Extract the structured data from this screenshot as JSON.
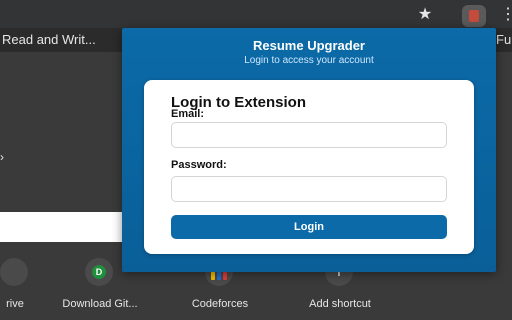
{
  "browser": {
    "star_icon": "★",
    "menu_icon": "⋮",
    "bookmarks": {
      "left_text": "Read and Writ...",
      "right_text": "Fu"
    }
  },
  "new_tab": {
    "left_chevron": "›",
    "shortcuts": [
      {
        "label": "rive",
        "icon": ""
      },
      {
        "label": "Download Git...",
        "icon": "D"
      },
      {
        "label": "Codeforces",
        "icon": ""
      },
      {
        "label": "Add shortcut",
        "icon": "+"
      }
    ]
  },
  "popup": {
    "title": "Resume Upgrader",
    "subtitle": "Login to access your account",
    "card": {
      "title": "Login to Extension",
      "email_label": "Email:",
      "email_value": "",
      "password_label": "Password:",
      "password_value": "",
      "login_button": "Login"
    }
  },
  "colors": {
    "popup_blue": "#0b6aa7",
    "browser_bg": "#2b2b2b"
  }
}
